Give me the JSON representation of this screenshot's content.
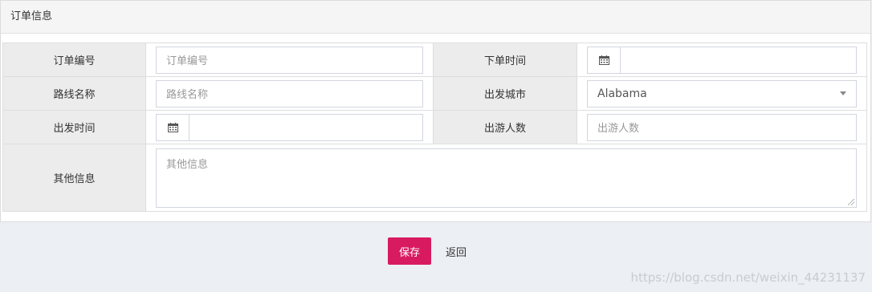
{
  "panel": {
    "title": "订单信息"
  },
  "form": {
    "order_no": {
      "label": "订单编号",
      "placeholder": "订单编号"
    },
    "order_time": {
      "label": "下单时间",
      "value": "",
      "icon": "calendar-icon"
    },
    "route_name": {
      "label": "路线名称",
      "placeholder": "路线名称"
    },
    "depart_city": {
      "label": "出发城市",
      "value": "Alabama"
    },
    "depart_time": {
      "label": "出发时间",
      "value": "",
      "icon": "calendar-icon"
    },
    "travelers": {
      "label": "出游人数",
      "placeholder": "出游人数"
    },
    "other_info": {
      "label": "其他信息",
      "placeholder": "其他信息"
    }
  },
  "actions": {
    "save_label": "保存",
    "back_label": "返回",
    "save_color": "#d81b60"
  },
  "watermark": "https://blog.csdn.net/weixin_44231137"
}
